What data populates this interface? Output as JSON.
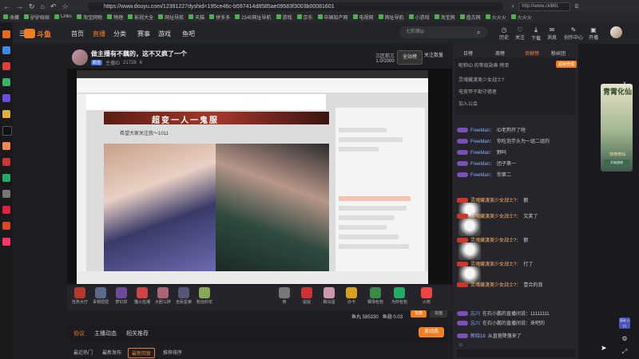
{
  "browser": {
    "url": "https://www.douyu.com/12391227dyshid=195ce46c-b597414d8585ae09583f3003b00081601",
    "search_box": "http://www.ckl86l.",
    "bookmarks": [
      "收藏",
      "驴驴娱娱",
      "Links",
      "淘宝网物",
      "物理",
      "影视大全",
      "网址导航",
      "天猫",
      "拼多多",
      "2345网址导航",
      "游戏",
      "京东",
      "中国知产网",
      "电视网",
      "网址导航",
      "小游戏",
      "淘宝网",
      "盘古网",
      "火火火",
      "火火火"
    ]
  },
  "header": {
    "logo": "斗鱼",
    "nav": [
      "首页",
      "直播",
      "分类",
      "赛事",
      "游戏",
      "鱼吧"
    ],
    "search_placeholder": "七彩原ip",
    "icons": [
      "历史",
      "关注",
      "下载",
      "消息",
      "创作中心",
      "开播"
    ]
  },
  "room": {
    "title": "做主播有不藕的，这不又疯了一个",
    "tag": "颜值",
    "streamer": "主播ID",
    "views": "21728",
    "fans": "6",
    "rank_label": "三区前三",
    "rank_value": "1.0/1000",
    "follow_label": "全站榜",
    "follow_count": "关注数量"
  },
  "inner_stream": {
    "banner": "超变一人一鬼服",
    "streamer_title": "希望大家关注我～1011"
  },
  "gifts": [
    {
      "name": "任务大厅",
      "color": "#b03a2e"
    },
    {
      "name": "青铜扭扭",
      "color": "#5a6a8a"
    },
    {
      "name": "梦幻宗",
      "color": "#6a4a9a"
    },
    {
      "name": "猫火狂潮",
      "color": "#c44"
    },
    {
      "name": "大胆三胖",
      "color": "#a67"
    },
    {
      "name": "全民星荣",
      "color": "#557"
    },
    {
      "name": "粉丝的花",
      "color": "#8a5"
    },
    {
      "name": "荧",
      "color": "#777"
    },
    {
      "name": "鼠鼠",
      "color": "#c33"
    },
    {
      "name": "稿乌蛋",
      "color": "#c9a"
    },
    {
      "name": "办卡",
      "color": "#d9a020"
    },
    {
      "name": "赛场包包",
      "color": "#3a8a4a"
    },
    {
      "name": "为你包包",
      "color": "#2a6"
    },
    {
      "name": "火箭",
      "color": "#e44"
    }
  ],
  "wallet": {
    "coins": "鱼丸 585330",
    "yuchi": "鱼翅 0.03",
    "recharge": "充值",
    "recharge2": "充值"
  },
  "lower_tabs": [
    "协议",
    "主播动态",
    "相关推荐"
  ],
  "task_button": "发动态",
  "sub_tabs": [
    "最近热门",
    "最新发布",
    "最新回复",
    "推荐排序"
  ],
  "chat": {
    "tabs": [
      "日榜",
      "周榜",
      "贡献榜",
      "粉丝团"
    ],
    "active_tab": "贡献榜",
    "badge": "超级管理",
    "rank_lines": [
      "昵称ID 的等级勋章 榜单",
      "灵魂藏渡美少女战士?",
      "电竞甲子勘守掳者",
      "加入公会"
    ],
    "messages": [
      {
        "user": "FreeMan：",
        "text": "ID老狗开了啥"
      },
      {
        "user": "FreeMan：",
        "text": "你吃泡芋头为一组二组的"
      },
      {
        "user": "FreeMan：",
        "text": "野吗"
      },
      {
        "user": "FreeMan：",
        "text": "团子第一"
      },
      {
        "user": "FreeMan：",
        "text": "你第二"
      },
      {
        "user": "灵魂藏渡美少女战士?：",
        "text": "额"
      },
      {
        "user": "灵魂藏渡美少女战士?：",
        "text": "又笑了"
      },
      {
        "user": "灵魂藏渡美少女战士?：",
        "text": "额"
      },
      {
        "user": "灵魂藏渡美少女战士?：",
        "text": "打了"
      },
      {
        "user": "灵魂藏渡美少女战士?：",
        "text": "壹合的我"
      },
      {
        "user": "忘川",
        "text": "在石小鹏的直播间说：11111111"
      },
      {
        "user": "忘川",
        "text": "在石小鹏的直播间说：来吧的"
      },
      {
        "user": "新晓18",
        "text": "从直营降落来了"
      }
    ]
  },
  "ad": {
    "title": "青霄化仙",
    "subtitle": "双修修仙",
    "button": "开始游戏"
  },
  "side_tag": "活动 入口"
}
